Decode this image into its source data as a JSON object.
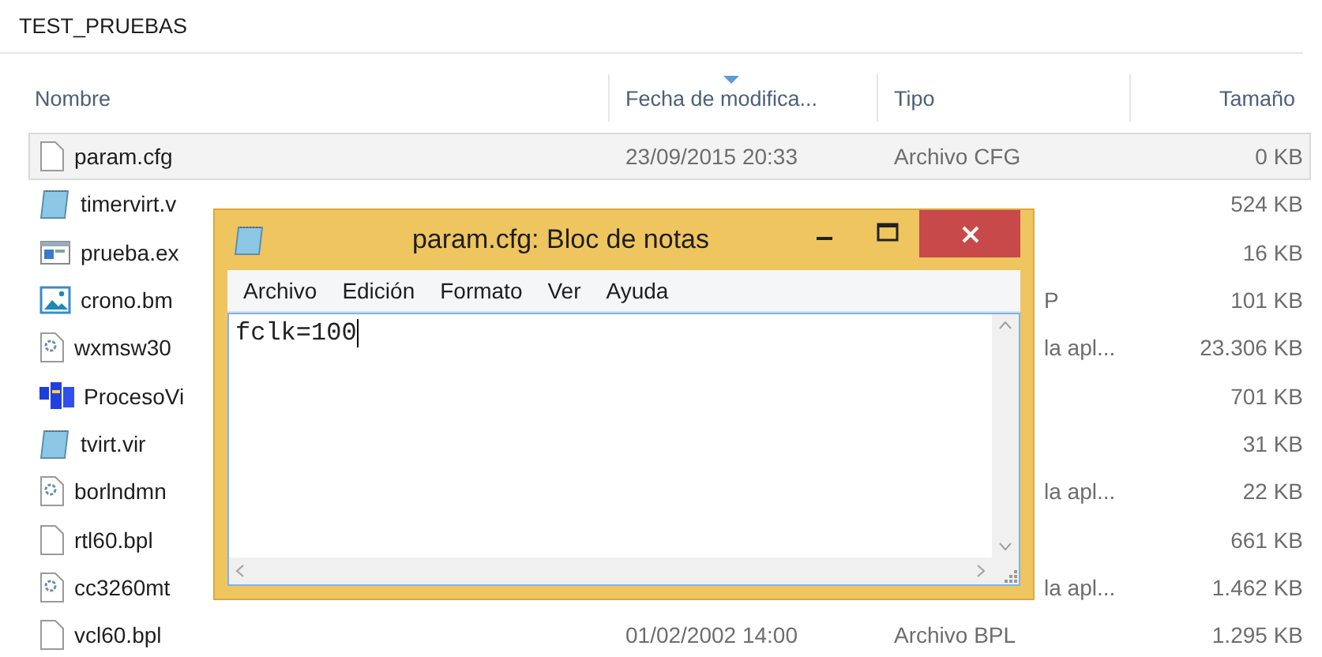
{
  "folder_title": "TEST_PRUEBAS",
  "columns": [
    {
      "label": "Nombre",
      "sorted": false
    },
    {
      "label": "Fecha de modifica...",
      "sorted": true
    },
    {
      "label": "Tipo",
      "sorted": false
    },
    {
      "label": "Tamaño",
      "sorted": false
    }
  ],
  "files": [
    {
      "kind": "blank",
      "name": "param.cfg",
      "date": "23/09/2015 20:33",
      "type": "Archivo CFG",
      "size": "0 KB",
      "selected": true
    },
    {
      "kind": "notepad",
      "name": "timervirt.v",
      "size": "524 KB",
      "selected": false
    },
    {
      "kind": "exe",
      "name": "prueba.ex",
      "size": "16 KB",
      "selected": false
    },
    {
      "kind": "image",
      "name": "crono.bm",
      "type_fragment": "P",
      "size": "101 KB",
      "selected": false
    },
    {
      "kind": "gear",
      "name": "wxmsw30",
      "type_fragment": "la apl...",
      "size": "23.306 KB",
      "selected": false
    },
    {
      "kind": "app",
      "name": "ProcesoVi",
      "size": "701 KB",
      "selected": false
    },
    {
      "kind": "notepad",
      "name": "tvirt.vir",
      "size": "31 KB",
      "selected": false
    },
    {
      "kind": "gear",
      "name": "borlndmn",
      "type_fragment": "la apl...",
      "size": "22 KB",
      "selected": false
    },
    {
      "kind": "blank",
      "name": "rtl60.bpl",
      "size": "661 KB",
      "selected": false
    },
    {
      "kind": "gear",
      "name": "cc3260mt",
      "type_fragment": "la apl...",
      "size": "1.462 KB",
      "selected": false
    },
    {
      "kind": "blank",
      "name": "vcl60.bpl",
      "date": "01/02/2002 14:00",
      "type": "Archivo BPL",
      "size": "1.295 KB",
      "selected": false
    }
  ],
  "notepad": {
    "title": "param.cfg: Bloc de notas",
    "menu": [
      "Archivo",
      "Edición",
      "Formato",
      "Ver",
      "Ayuda"
    ],
    "content": "fclk=100"
  }
}
